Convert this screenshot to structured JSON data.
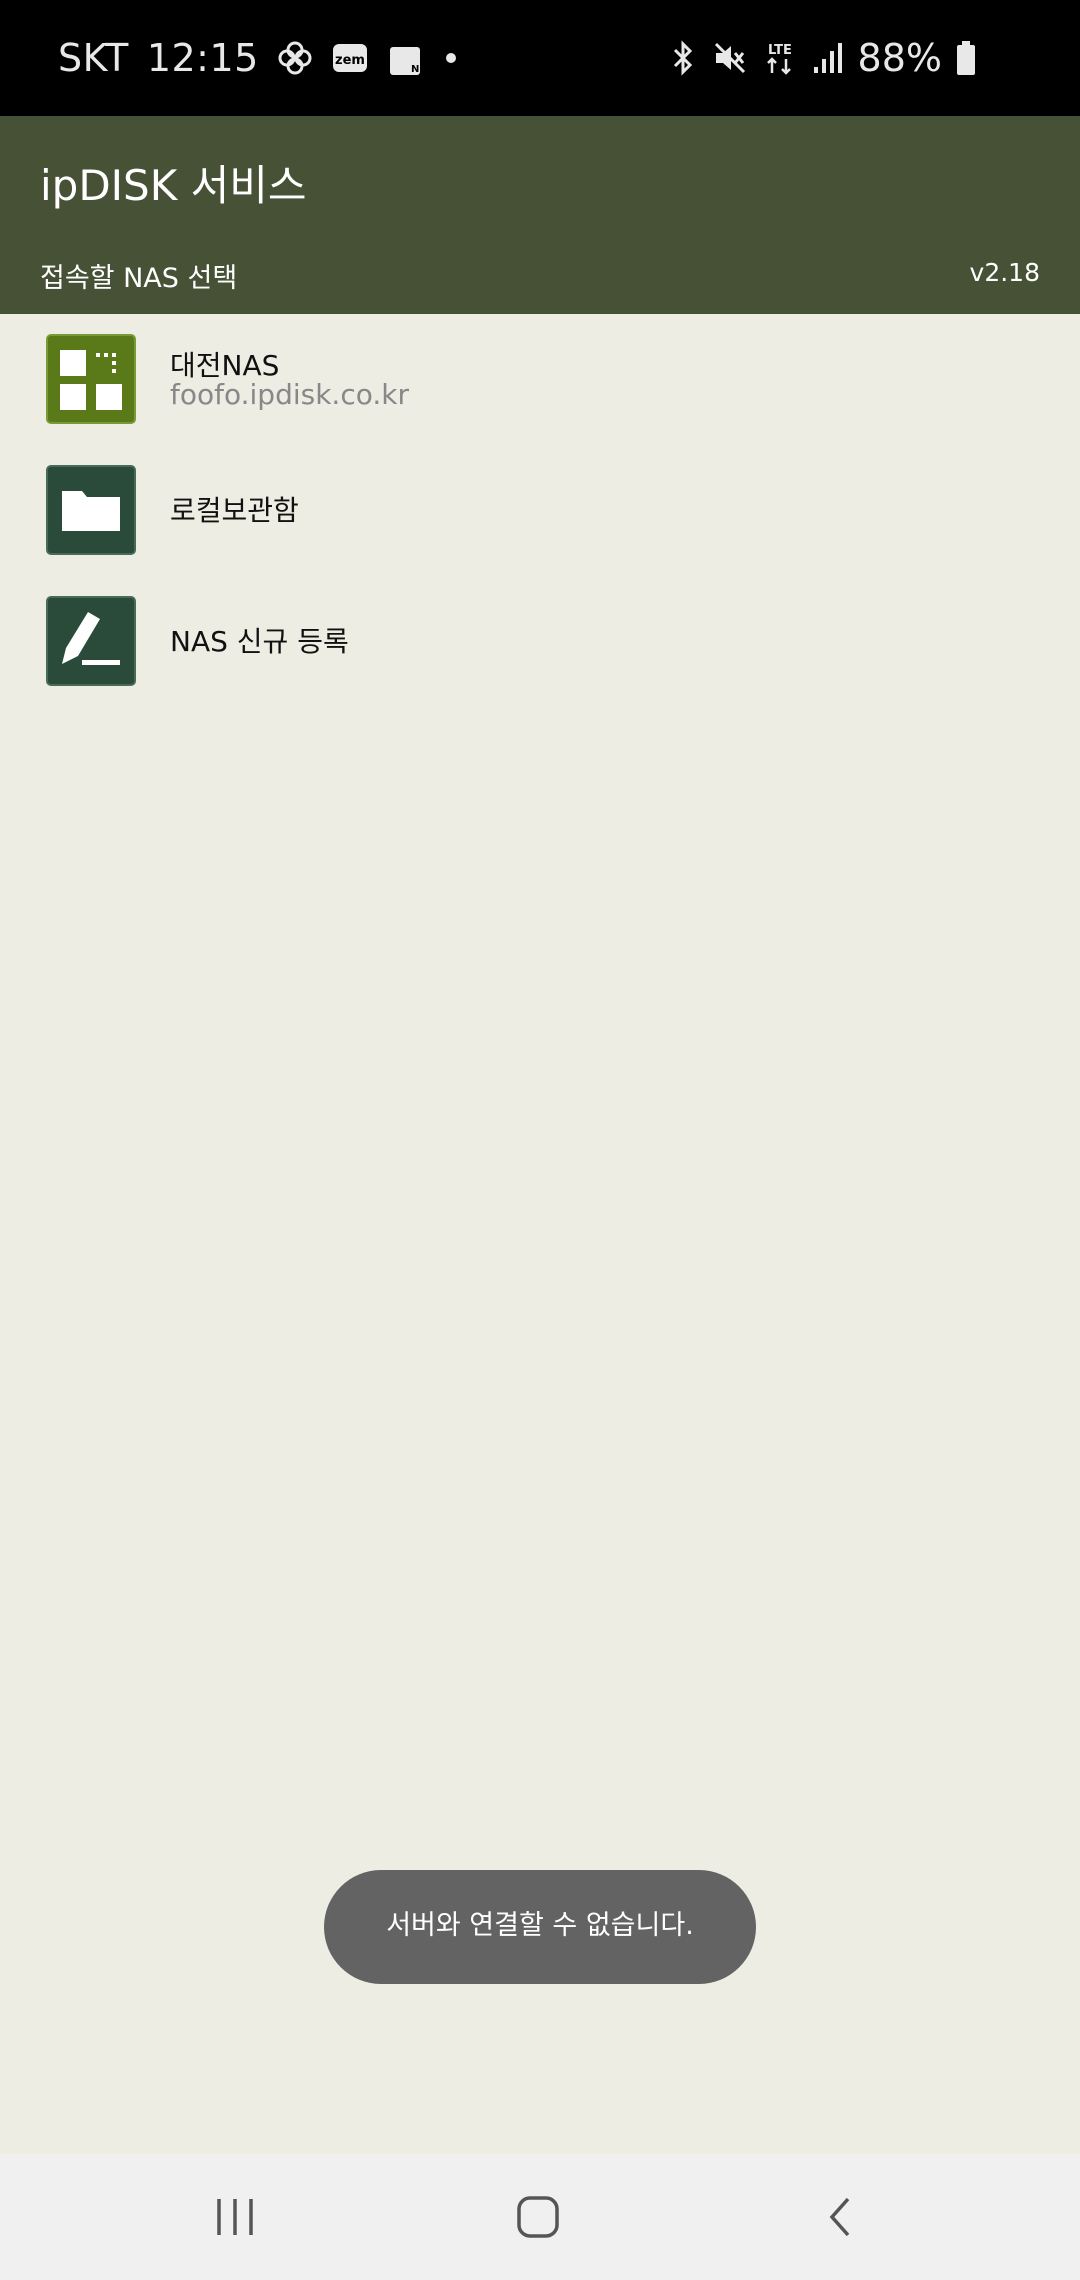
{
  "status_bar": {
    "carrier": "SKT",
    "time": "12:15",
    "battery": "88%",
    "left_icons": [
      "pinwheel-icon",
      "zem-app-icon",
      "shopping-bag-icon",
      "dot-icon"
    ],
    "right_icons": [
      "bluetooth-icon",
      "mute-icon",
      "lte-icon",
      "signal-icon",
      "battery-icon"
    ]
  },
  "header": {
    "title": "ipDISK 서비스",
    "subtitle": "접속할 NAS 선택",
    "version": "v2.18",
    "color": "#475136"
  },
  "nas_list": [
    {
      "name": "대전NAS",
      "host": "foofo.ipdisk.co.kr",
      "icon": "nas-grid-icon",
      "icon_color": "#5a7a1a"
    },
    {
      "name": "로컬보관함",
      "host": "",
      "icon": "folder-icon",
      "icon_color": "#2a4a3a"
    },
    {
      "name": "NAS 신규 등록",
      "host": "",
      "icon": "pen-icon",
      "icon_color": "#2a4a3a"
    }
  ],
  "toast": {
    "message": "서버와 연결할 수 없습니다."
  },
  "nav": {
    "buttons": [
      "recent-apps-icon",
      "home-icon",
      "back-icon"
    ]
  }
}
